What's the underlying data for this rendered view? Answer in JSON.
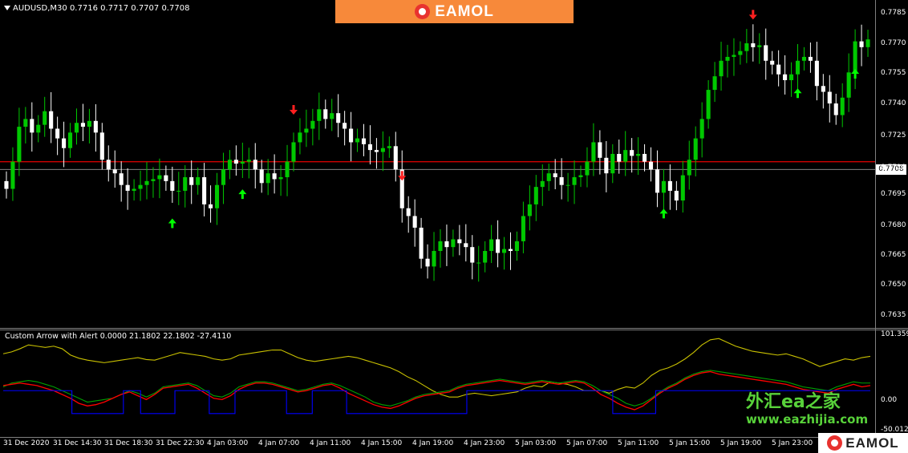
{
  "chart": {
    "title": "AUDUSD,M30  0.7716 0.7717 0.7707 0.7708",
    "current_price": "0.7708",
    "y_ticks": [
      "0.7785",
      "0.7770",
      "0.7755",
      "0.7740",
      "0.7725",
      "0.7710",
      "0.7695",
      "0.7680",
      "0.7665",
      "0.7650",
      "0.7635"
    ],
    "x_ticks": [
      "31 Dec 2020",
      "31 Dec 14:30",
      "31 Dec 18:30",
      "31 Dec 22:30",
      "4 Jan 03:00",
      "4 Jan 07:00",
      "4 Jan 11:00",
      "4 Jan 15:00",
      "4 Jan 19:00",
      "4 Jan 23:00",
      "5 Jan 03:00",
      "5 Jan 07:00",
      "5 Jan 11:00",
      "5 Jan 15:00",
      "5 Jan 19:00",
      "5 Jan 23:00"
    ]
  },
  "indicator": {
    "title": "Custom Arrow with Alert 0.0000 21.1802 22.1802 -27.4110",
    "y_ticks": [
      "101.3599",
      "0.00",
      "-50.0122"
    ]
  },
  "brand": {
    "top": "EAMOL",
    "bottom": "EAMOL"
  },
  "watermark": {
    "cn": "外汇ea之家",
    "url": "www.eazhijia.com"
  },
  "colors": {
    "bull": "#00c800",
    "bear": "#ffffff",
    "up_arrow": "#00ff00",
    "down_arrow": "#ff2020",
    "h_line": "#d00000",
    "ask_line": "#808080",
    "line_yellow": "#c8c000",
    "line_green": "#00a000",
    "line_red": "#ff0000",
    "line_blue": "#0000ff"
  },
  "chart_data": {
    "type": "candlestick",
    "symbol": "AUDUSD",
    "timeframe": "M30",
    "ylim": [
      0.7628,
      0.7792
    ],
    "closes": [
      0.7698,
      0.7712,
      0.773,
      0.7734,
      0.7727,
      0.7731,
      0.7738,
      0.7729,
      0.7724,
      0.7719,
      0.7727,
      0.7732,
      0.773,
      0.7733,
      0.7727,
      0.7713,
      0.7708,
      0.7706,
      0.77,
      0.7697,
      0.7698,
      0.77,
      0.7702,
      0.7703,
      0.7705,
      0.7702,
      0.7697,
      0.7697,
      0.7704,
      0.77,
      0.7704,
      0.769,
      0.7688,
      0.77,
      0.7708,
      0.7713,
      0.7711,
      0.7712,
      0.7713,
      0.7708,
      0.7701,
      0.7706,
      0.7703,
      0.7704,
      0.7712,
      0.7722,
      0.7727,
      0.7729,
      0.7733,
      0.7739,
      0.7734,
      0.7737,
      0.7732,
      0.7729,
      0.7722,
      0.7724,
      0.7721,
      0.7718,
      0.7717,
      0.7719,
      0.772,
      0.7708,
      0.7688,
      0.7684,
      0.7678,
      0.7662,
      0.7658,
      0.7666,
      0.7671,
      0.7668,
      0.7672,
      0.767,
      0.7668,
      0.766,
      0.766,
      0.7666,
      0.7672,
      0.7665,
      0.7667,
      0.7666,
      0.7671,
      0.7684,
      0.769,
      0.7699,
      0.7702,
      0.7706,
      0.7704,
      0.77,
      0.77,
      0.7704,
      0.7705,
      0.7712,
      0.7722,
      0.7714,
      0.7706,
      0.7716,
      0.7712,
      0.7718,
      0.7715,
      0.7716,
      0.7712,
      0.7708,
      0.7696,
      0.7702,
      0.7697,
      0.7692,
      0.7705,
      0.7713,
      0.7724,
      0.7734,
      0.7749,
      0.7756,
      0.7764,
      0.7766,
      0.7767,
      0.7769,
      0.7773,
      0.7771,
      0.7772,
      0.7764,
      0.7762,
      0.7757,
      0.7754,
      0.7757,
      0.7764,
      0.7766,
      0.7764,
      0.7751,
      0.7748,
      0.7742,
      0.7736,
      0.7745,
      0.7758,
      0.7774,
      0.7771,
      0.7775
    ],
    "up_arrows_at": [
      26,
      37,
      103,
      124,
      133
    ],
    "down_arrows_at": [
      45,
      62,
      117
    ],
    "h_line": 0.7712,
    "indicator": {
      "ylim": [
        -50.0122,
        101.3599
      ],
      "series": [
        {
          "name": "yellow",
          "values": [
            72,
            75,
            80,
            86,
            84,
            82,
            84,
            80,
            70,
            65,
            62,
            60,
            58,
            60,
            62,
            64,
            66,
            63,
            62,
            66,
            70,
            74,
            72,
            70,
            68,
            64,
            62,
            64,
            70,
            72,
            74,
            76,
            78,
            78,
            72,
            66,
            62,
            60,
            62,
            64,
            66,
            68,
            66,
            62,
            58,
            54,
            50,
            44,
            36,
            30,
            22,
            14,
            8,
            4,
            4,
            8,
            10,
            8,
            6,
            8,
            10,
            12,
            18,
            22,
            20,
            28,
            26,
            24,
            20,
            14,
            14,
            14,
            10,
            16,
            20,
            18,
            26,
            38,
            46,
            50,
            56,
            64,
            74,
            86,
            94,
            96,
            90,
            84,
            80,
            76,
            74,
            72,
            70,
            72,
            68,
            64,
            58,
            52,
            56,
            60,
            64,
            62,
            66,
            68
          ]
        },
        {
          "name": "green",
          "values": [
            20,
            26,
            28,
            30,
            28,
            24,
            20,
            14,
            8,
            2,
            -4,
            -2,
            0,
            2,
            8,
            14,
            10,
            4,
            10,
            20,
            22,
            24,
            26,
            22,
            14,
            6,
            4,
            10,
            20,
            24,
            28,
            28,
            26,
            22,
            18,
            14,
            16,
            20,
            24,
            26,
            22,
            16,
            10,
            4,
            -4,
            -8,
            -10,
            -6,
            -2,
            4,
            8,
            10,
            12,
            14,
            20,
            24,
            26,
            28,
            30,
            32,
            30,
            28,
            26,
            28,
            30,
            28,
            26,
            28,
            30,
            28,
            22,
            14,
            8,
            2,
            -6,
            -10,
            -6,
            2,
            12,
            20,
            26,
            34,
            40,
            44,
            46,
            44,
            42,
            40,
            38,
            36,
            34,
            32,
            30,
            28,
            24,
            20,
            18,
            16,
            14,
            20,
            24,
            28,
            26,
            26
          ]
        },
        {
          "name": "red",
          "values": [
            22,
            24,
            26,
            24,
            22,
            18,
            14,
            8,
            2,
            -6,
            -10,
            -8,
            -4,
            2,
            8,
            12,
            6,
            0,
            8,
            18,
            20,
            22,
            24,
            18,
            10,
            2,
            0,
            6,
            16,
            22,
            26,
            26,
            24,
            20,
            16,
            12,
            14,
            18,
            22,
            24,
            18,
            10,
            4,
            -2,
            -8,
            -12,
            -14,
            -10,
            -4,
            2,
            6,
            8,
            10,
            12,
            18,
            22,
            24,
            26,
            28,
            30,
            28,
            26,
            24,
            26,
            28,
            26,
            24,
            26,
            28,
            26,
            18,
            8,
            2,
            -6,
            -12,
            -16,
            -10,
            0,
            10,
            18,
            24,
            32,
            38,
            42,
            44,
            40,
            38,
            36,
            34,
            32,
            30,
            28,
            26,
            24,
            20,
            16,
            14,
            12,
            10,
            16,
            20,
            24,
            20,
            22
          ]
        },
        {
          "name": "blue",
          "values": [
            14,
            14,
            14,
            14,
            14,
            14,
            14,
            14,
            -22,
            -22,
            -22,
            -22,
            -22,
            -22,
            14,
            14,
            -22,
            -22,
            -22,
            -22,
            14,
            14,
            14,
            14,
            -22,
            -22,
            -22,
            14,
            14,
            14,
            14,
            14,
            14,
            -22,
            -22,
            -22,
            14,
            14,
            14,
            14,
            -22,
            -22,
            -22,
            -22,
            -22,
            -22,
            -22,
            -22,
            -22,
            -22,
            -22,
            -22,
            -22,
            -22,
            14,
            14,
            14,
            14,
            14,
            14,
            14,
            14,
            14,
            14,
            14,
            14,
            14,
            14,
            14,
            14,
            14,
            -22,
            -22,
            -22,
            -22,
            -22,
            14,
            14,
            14,
            14,
            14,
            14,
            14,
            14,
            14,
            14,
            14,
            14,
            14,
            14,
            14,
            14,
            14,
            14,
            14,
            14,
            14,
            14,
            14,
            14,
            14,
            14
          ]
        }
      ]
    }
  }
}
